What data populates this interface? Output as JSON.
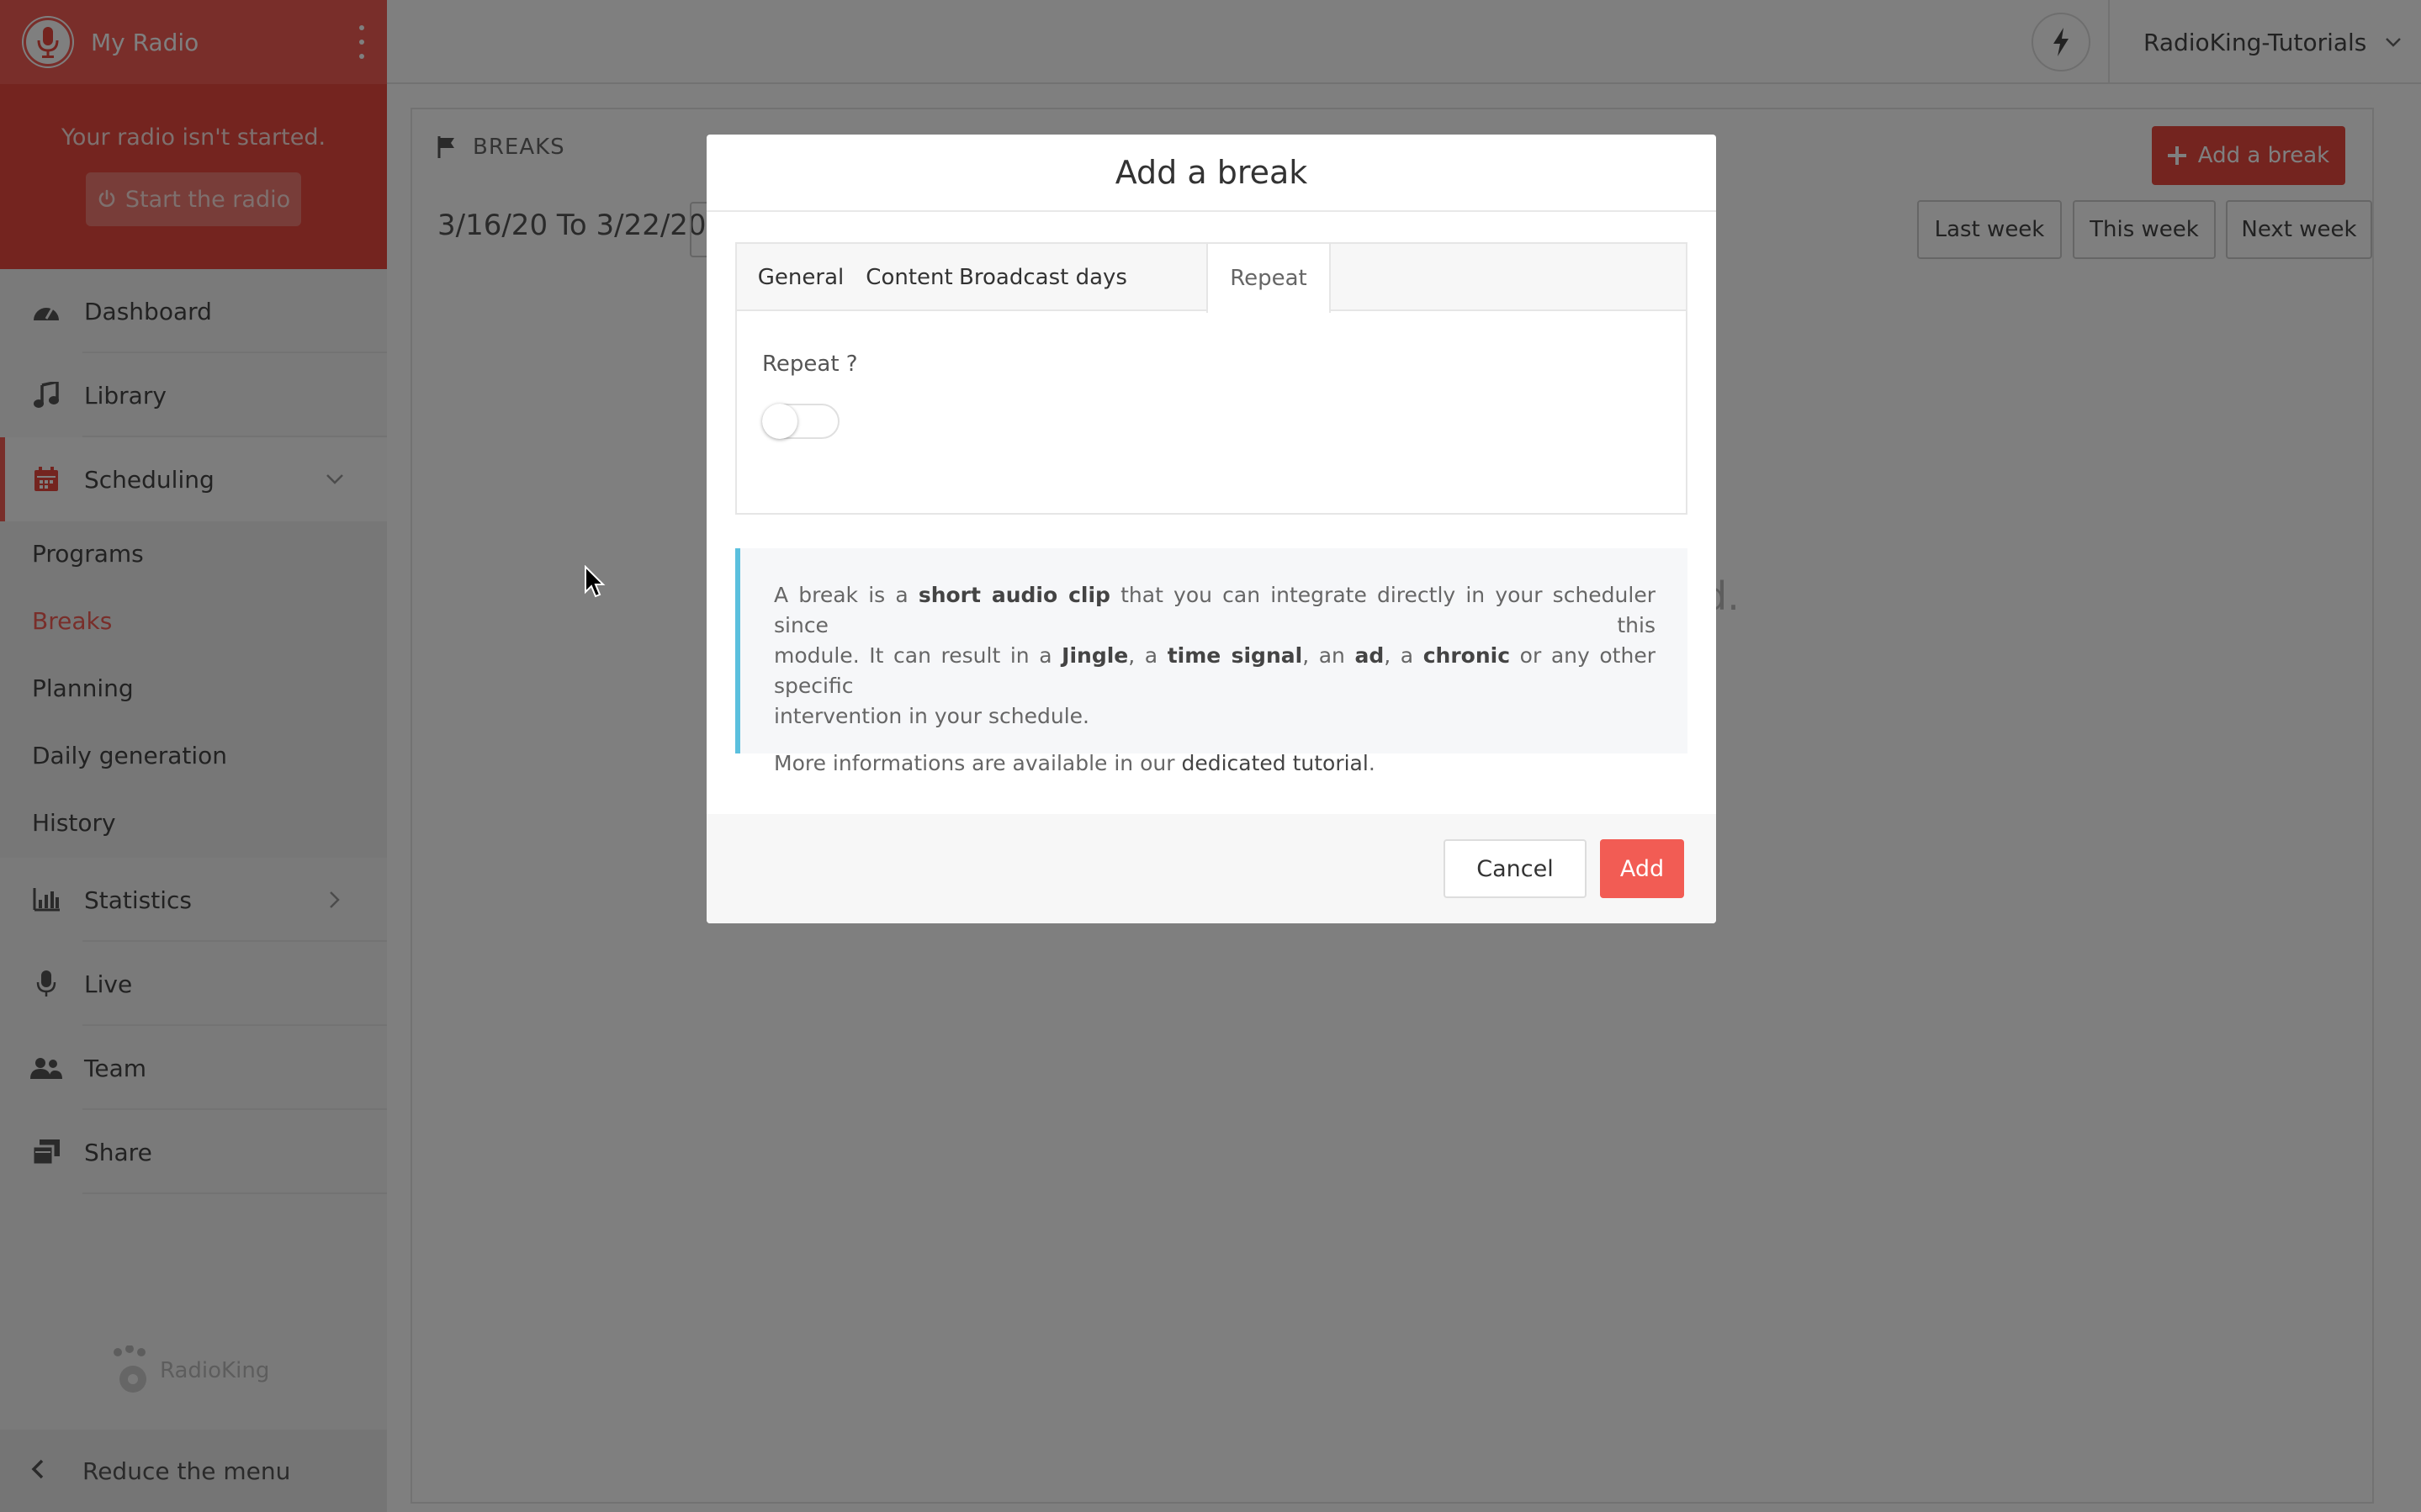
{
  "sidebar": {
    "brand_name": "My Radio",
    "radio_status": "Your radio isn't started.",
    "start_button": "Start the radio",
    "nav": {
      "dashboard": "Dashboard",
      "library": "Library",
      "scheduling": "Scheduling",
      "statistics": "Statistics",
      "live": "Live",
      "team": "Team",
      "share": "Share"
    },
    "scheduling_sub": [
      "Programs",
      "Breaks",
      "Planning",
      "Daily generation",
      "History"
    ],
    "footer_logo_text": "RadioKing",
    "reduce_menu": "Reduce the menu"
  },
  "topbar": {
    "account_name": "RadioKing-Tutorials"
  },
  "main": {
    "breadcrumb": "BREAKS",
    "add_break_button": "Add a break",
    "date_range": "3/16/20 To 3/22/20",
    "week_buttons": [
      "Last week",
      "This week",
      "Next week"
    ],
    "empty_fragment": "d."
  },
  "modal": {
    "title": "Add a break",
    "tabs": [
      "General",
      "Content",
      "Broadcast days",
      "Repeat"
    ],
    "active_tab": "Repeat",
    "repeat_label": "Repeat ?",
    "repeat_enabled": false,
    "info": {
      "line1_a": "A break is a ",
      "line1_b": "short audio clip",
      "line1_c": " that you can integrate directly in your scheduler since this",
      "line2_a": "module. It can result in a ",
      "line2_b": "Jingle",
      "line2_c": ", a ",
      "line2_d": "time signal",
      "line2_e": ", an ",
      "line2_f": "ad",
      "line2_g": ", a ",
      "line2_h": "chronic",
      "line2_i": " or any other specific",
      "line3": "intervention in your schedule.",
      "more_prefix": "More informations are available in our ",
      "more_link": "dedicated tutorial",
      "more_suffix": "."
    },
    "cancel_button": "Cancel",
    "add_button": "Add"
  },
  "colors": {
    "brand": "#f25c54",
    "brand_dark": "#e8483f",
    "info_accent": "#5bc0de"
  }
}
